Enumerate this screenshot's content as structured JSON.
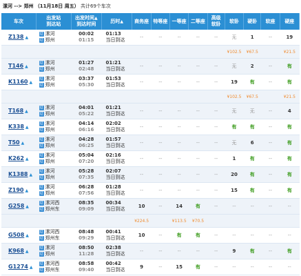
{
  "summary": {
    "route": "漯河 --> 郑州",
    "date": "（11月18日  周五）",
    "count": "共计69个车次"
  },
  "headers": {
    "train": "车次",
    "stations1": "出发站",
    "stations2": "到达站",
    "times1": "出发时间",
    "times2": "到达时间",
    "duration": "历时",
    "business": "商务座",
    "special": "特等座",
    "first": "一等座",
    "second": "二等座",
    "adv_soft1": "高级",
    "adv_soft2": "软卧",
    "soft_sleeper": "软卧",
    "hard_sleeper": "硬卧",
    "soft_seat": "软座",
    "hard_seat": "硬座",
    "sort_arrow": "▲"
  },
  "icons": {
    "start": "始",
    "end": "终",
    "pass": "过"
  },
  "rows": [
    {
      "train": "Z138",
      "from": "漯河",
      "to": "郑州",
      "from_type": "pass",
      "to_type": "pass",
      "dep": "00:02",
      "arr": "01:15",
      "dur": "01:13",
      "day": "当日到达",
      "seats": [
        "--",
        "--",
        "--",
        "--",
        "--",
        "无",
        "1",
        "--",
        "19"
      ],
      "prices": [
        "",
        "",
        "",
        "",
        "",
        "¥102.5",
        "¥67.5",
        "",
        "¥21.5"
      ]
    },
    {
      "train": "T146",
      "from": "漯河",
      "to": "郑州",
      "from_type": "pass",
      "to_type": "pass",
      "dep": "01:27",
      "arr": "02:48",
      "dur": "01:21",
      "day": "当日到达",
      "seats": [
        "--",
        "--",
        "--",
        "--",
        "--",
        "无",
        "2",
        "--",
        "有"
      ]
    },
    {
      "train": "K1160",
      "from": "漯河",
      "to": "郑州",
      "from_type": "pass",
      "to_type": "pass",
      "dep": "03:37",
      "arr": "05:30",
      "dur": "01:53",
      "day": "当日到达",
      "seats": [
        "--",
        "--",
        "--",
        "--",
        "--",
        "19",
        "有",
        "--",
        "有"
      ],
      "prices": [
        "",
        "",
        "",
        "",
        "",
        "¥102.5",
        "¥67.5",
        "",
        "¥21.5"
      ]
    },
    {
      "train": "T168",
      "from": "漯河",
      "to": "郑州",
      "from_type": "pass",
      "to_type": "pass",
      "dep": "04:01",
      "arr": "05:22",
      "dur": "01:21",
      "day": "当日到达",
      "seats": [
        "--",
        "--",
        "--",
        "--",
        "--",
        "无",
        "无",
        "--",
        "4"
      ]
    },
    {
      "train": "K338",
      "from": "漯河",
      "to": "郑州",
      "from_type": "pass",
      "to_type": "pass",
      "dep": "04:14",
      "arr": "06:16",
      "dur": "02:02",
      "day": "当日到达",
      "seats": [
        "--",
        "--",
        "--",
        "--",
        "--",
        "有",
        "有",
        "--",
        "有"
      ]
    },
    {
      "train": "T50",
      "from": "漯河",
      "to": "郑州",
      "from_type": "pass",
      "to_type": "pass",
      "dep": "04:28",
      "arr": "06:25",
      "dur": "01:57",
      "day": "当日到达",
      "seats": [
        "--",
        "--",
        "--",
        "--",
        "--",
        "无",
        "6",
        "--",
        "有"
      ]
    },
    {
      "train": "K262",
      "from": "漯河",
      "to": "郑州",
      "from_type": "pass",
      "to_type": "pass",
      "dep": "05:04",
      "arr": "07:20",
      "dur": "02:16",
      "day": "当日到达",
      "seats": [
        "--",
        "--",
        "--",
        "--",
        "--",
        "1",
        "有",
        "--",
        "有"
      ]
    },
    {
      "train": "K1388",
      "from": "漯河",
      "to": "郑州",
      "from_type": "pass",
      "to_type": "pass",
      "dep": "05:28",
      "arr": "07:35",
      "dur": "02:07",
      "day": "当日到达",
      "seats": [
        "--",
        "--",
        "--",
        "--",
        "--",
        "20",
        "有",
        "--",
        "有"
      ]
    },
    {
      "train": "Z190",
      "from": "漯河",
      "to": "郑州",
      "from_type": "pass",
      "to_type": "pass",
      "dep": "06:28",
      "arr": "07:56",
      "dur": "01:28",
      "day": "当日到达",
      "seats": [
        "--",
        "--",
        "--",
        "--",
        "--",
        "15",
        "有",
        "--",
        "有"
      ]
    },
    {
      "train": "G258",
      "from": "漯河西",
      "to": "郑州东",
      "from_type": "pass",
      "to_type": "pass",
      "dep": "08:35",
      "arr": "09:09",
      "dur": "00:34",
      "day": "当日到达",
      "seats": [
        "10",
        "--",
        "14",
        "有",
        "--",
        "--",
        "--",
        "--",
        "--"
      ],
      "prices": [
        "¥224.5",
        "",
        "¥113.5",
        "¥70.5",
        "",
        "",
        "",
        "",
        ""
      ]
    },
    {
      "train": "G508",
      "from": "漯河西",
      "to": "郑州东",
      "from_type": "pass",
      "to_type": "pass",
      "dep": "08:48",
      "arr": "09:29",
      "dur": "00:41",
      "day": "当日到达",
      "seats": [
        "10",
        "--",
        "有",
        "有",
        "--",
        "--",
        "--",
        "--",
        "--"
      ]
    },
    {
      "train": "K968",
      "from": "漯河",
      "to": "郑州",
      "from_type": "pass",
      "to_type": "pass",
      "dep": "08:50",
      "arr": "11:28",
      "dur": "02:38",
      "day": "当日到达",
      "seats": [
        "--",
        "--",
        "--",
        "--",
        "--",
        "9",
        "有",
        "--",
        "有"
      ]
    },
    {
      "train": "G1274",
      "from": "漯河西",
      "to": "郑州东",
      "from_type": "pass",
      "to_type": "pass",
      "dep": "08:58",
      "arr": "09:40",
      "dur": "00:42",
      "day": "当日到达",
      "seats": [
        "9",
        "--",
        "15",
        "有",
        "--",
        "--",
        "--",
        "--",
        "--"
      ]
    }
  ]
}
